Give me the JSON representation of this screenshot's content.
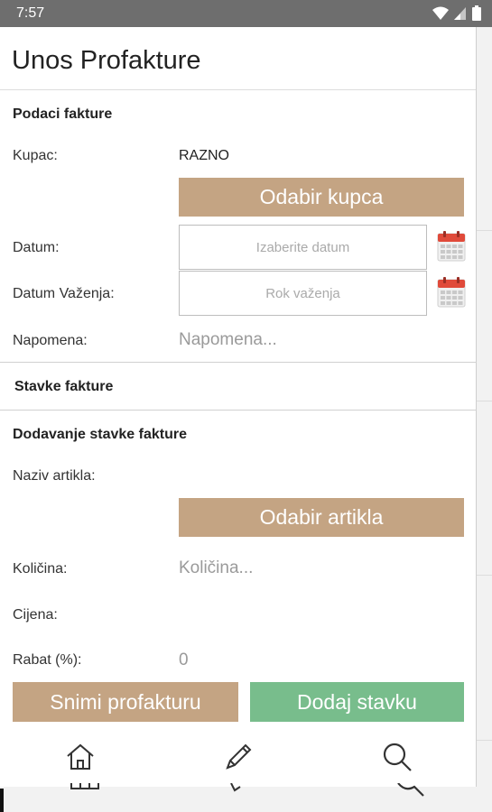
{
  "status_bar": {
    "time": "7:57"
  },
  "app_bar": {
    "title": "Unos Profakture"
  },
  "invoice_data": {
    "section_title": "Podaci fakture",
    "customer_label": "Kupac:",
    "customer_value": "RAZNO",
    "choose_customer_button": "Odabir kupca",
    "date_label": "Datum:",
    "date_placeholder": "Izaberite datum",
    "validity_label": "Datum Važenja:",
    "validity_placeholder": "Rok važenja",
    "note_label": "Napomena:",
    "note_placeholder": "Napomena..."
  },
  "items_tab": {
    "title": "Stavke fakture"
  },
  "add_item": {
    "section_title": "Dodavanje stavke fakture",
    "article_label": "Naziv artikla:",
    "choose_article_button": "Odabir artikla",
    "quantity_label": "Količina:",
    "quantity_placeholder": "Količina...",
    "price_label": "Cijena:",
    "discount_label": "Rabat (%):",
    "discount_value": "0"
  },
  "actions": {
    "save_button": "Snimi profakturu",
    "add_item_button": "Dodaj stavku"
  },
  "bottom_nav": {
    "items": [
      "home-icon",
      "pencil-icon",
      "search-icon"
    ]
  },
  "colors": {
    "tan_button": "#c4a483",
    "green_button": "#78bd8c",
    "status_bar": "#6e6e6e"
  }
}
